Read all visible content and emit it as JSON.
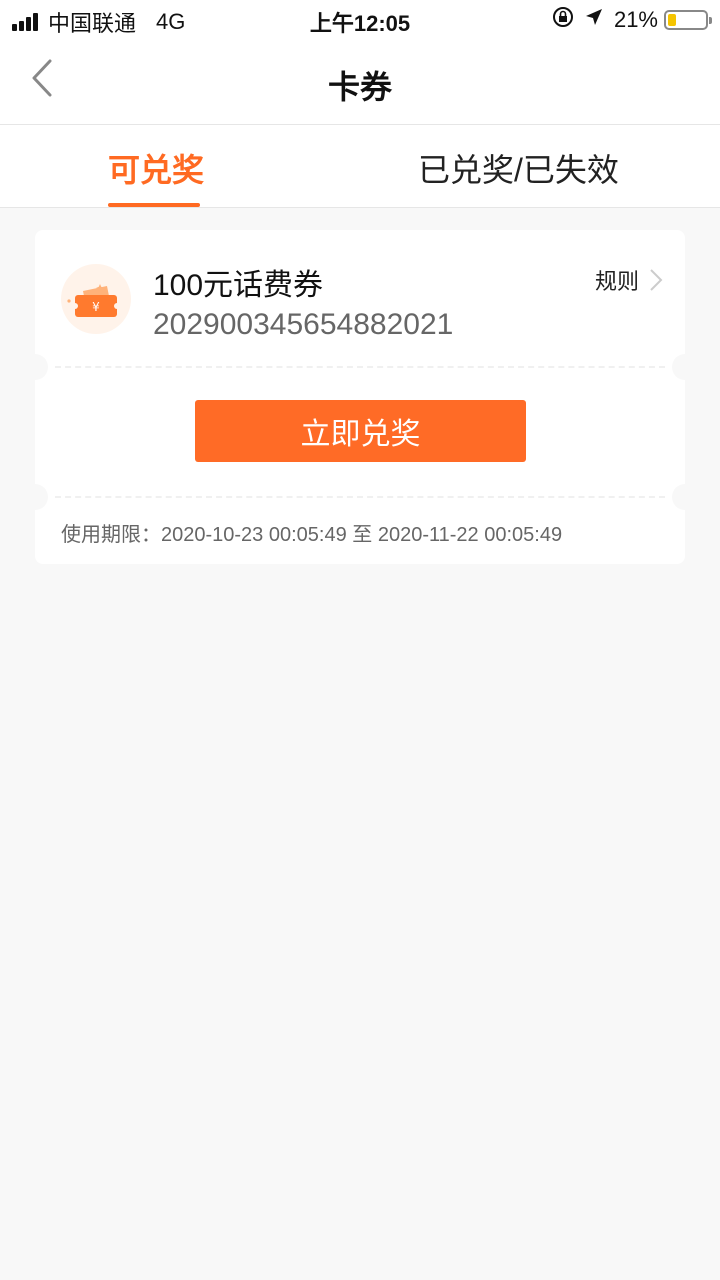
{
  "status_bar": {
    "carrier": "中国联通",
    "network": "4G",
    "time": "上午12:05",
    "battery_text": "21%",
    "battery_level": 0.21,
    "icons": [
      "signal-icon",
      "orientation-lock-icon",
      "location-arrow-icon",
      "battery-icon"
    ]
  },
  "nav": {
    "title": "卡券",
    "back_icon": "chevron-left-icon"
  },
  "tabs": {
    "active_label": "可兑奖",
    "inactive_label": "已兑奖/已失效"
  },
  "coupon": {
    "title": "100元话费券",
    "code": "202900345654882021",
    "rules_label": "规则",
    "redeem_label": "立即兑奖",
    "validity_label": "使用期限：",
    "validity_start": "2020-10-23 00:05:49",
    "validity_sep": "至",
    "validity_end": "2020-11-22 00:05:49",
    "icon": "ticket-icon"
  },
  "colors": {
    "accent": "#ff6a22",
    "background": "#f8f8f8"
  }
}
